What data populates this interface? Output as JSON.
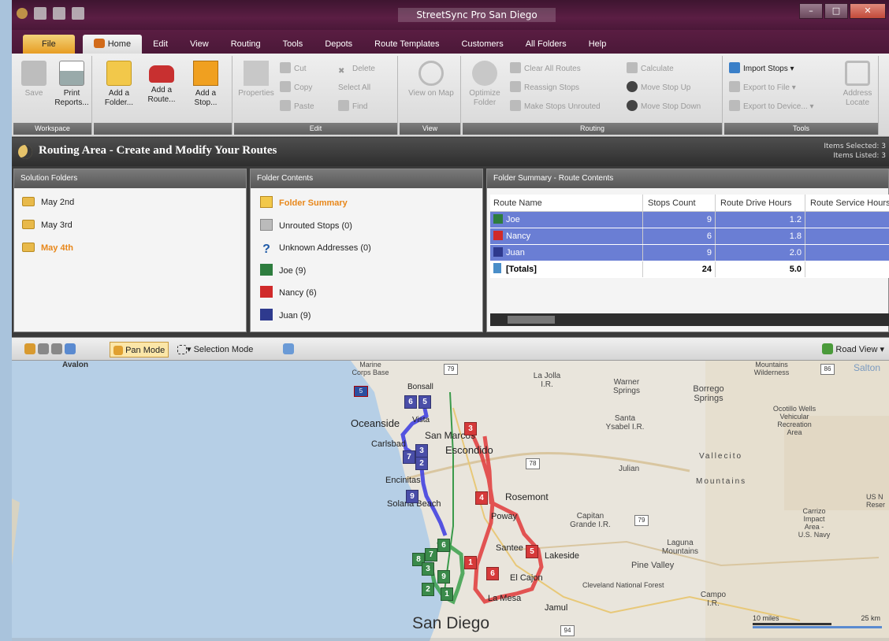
{
  "window": {
    "title": "StreetSync Pro San Diego"
  },
  "tabs": [
    "File",
    "Home",
    "Edit",
    "View",
    "Routing",
    "Tools",
    "Depots",
    "Route Templates",
    "Customers",
    "All Folders",
    "Help"
  ],
  "ribbon": {
    "workspace": {
      "name": "Workspace",
      "save": "Save",
      "print": "Print Reports..."
    },
    "new": {
      "add_folder": "Add a Folder...",
      "add_route": "Add a Route...",
      "add_stop": "Add a Stop..."
    },
    "edit": {
      "name": "Edit",
      "properties": "Properties",
      "cut": "Cut",
      "copy": "Copy",
      "paste": "Paste",
      "delete": "Delete",
      "select_all": "Select All",
      "find": "Find"
    },
    "view": {
      "name": "View",
      "view_on_map": "View on Map"
    },
    "routing": {
      "name": "Routing",
      "optimize": "Optimize Folder",
      "clear_all": "Clear All Routes",
      "reassign": "Reassign Stops",
      "unrouted": "Make Stops Unrouted",
      "calculate": "Calculate",
      "move_up": "Move Stop Up",
      "move_down": "Move Stop Down"
    },
    "tools": {
      "name": "Tools",
      "import": "Import Stops",
      "export_file": "Export to File",
      "export_device": "Export to Device...",
      "address_locate": "Address Locate"
    }
  },
  "area": {
    "title": "Routing Area - Create and Modify Your Routes",
    "items_selected": "Items Selected: 3",
    "items_listed": "Items Listed: 3"
  },
  "solution_folders": {
    "header": "Solution Folders",
    "items": [
      "May 2nd",
      "May 3rd",
      "May 4th"
    ]
  },
  "folder_contents": {
    "header": "Folder Contents",
    "items": [
      "Folder Summary",
      "Unrouted Stops (0)",
      "Unknown Addresses (0)",
      "Joe (9)",
      "Nancy (6)",
      "Juan (9)"
    ]
  },
  "summary": {
    "header": "Folder Summary - Route Contents",
    "columns": [
      "Route Name",
      "Stops Count",
      "Route Drive Hours",
      "Route Service Hours"
    ],
    "rows": [
      {
        "name": "Joe",
        "stops": "9",
        "hours": "1.2"
      },
      {
        "name": "Nancy",
        "stops": "6",
        "hours": "1.8"
      },
      {
        "name": "Juan",
        "stops": "9",
        "hours": "2.0"
      }
    ],
    "totals": {
      "name": "[Totals]",
      "stops": "24",
      "hours": "5.0"
    }
  },
  "map_toolbar": {
    "pan": "Pan Mode",
    "select": "Selection Mode",
    "view": "Road View"
  },
  "map": {
    "labels": {
      "avalon": "Avalon",
      "marine": "Marine Corps Base",
      "bonsall": "Bonsall",
      "oceanside": "Oceanside",
      "vista": "Vista",
      "sanmarcos": "San Marcos",
      "carlsbad": "Carlsbad",
      "escondido": "Escondido",
      "encinitas": "Encinitas",
      "solana": "Solana Beach",
      "rosemont": "Rosemont",
      "poway": "Poway",
      "santee": "Santee",
      "lakeside": "Lakeside",
      "elcajon": "El Cajon",
      "lamesa": "La Mesa",
      "jamul": "Jamul",
      "sandiego": "San Diego",
      "lajolla": "La Jolla I.R.",
      "warner": "Warner Springs",
      "borrego": "Borrego Springs",
      "santaysabel": "Santa Ysabel I.R.",
      "julian": "Julian",
      "vallecito": "Vallecito",
      "mountains": "Mountains",
      "capitan": "Capitan Grande I.R.",
      "laguna": "Laguna Mountains",
      "pinevalley": "Pine Valley",
      "cleveland": "Cleveland National Forest",
      "campo": "Campo I.R.",
      "mountainswild": "Mountains Wilderness",
      "salton": "Salton",
      "ocotillo": "Ocotillo Wells Vehicular Recreation Area",
      "carrizo": "Carrizo Impact Area - U.S. Navy",
      "usn": "US N Reser"
    },
    "highways": [
      "79",
      "78",
      "78",
      "79",
      "86",
      "94",
      "5"
    ],
    "scale": {
      "miles": "10 miles",
      "km": "25 km"
    }
  }
}
